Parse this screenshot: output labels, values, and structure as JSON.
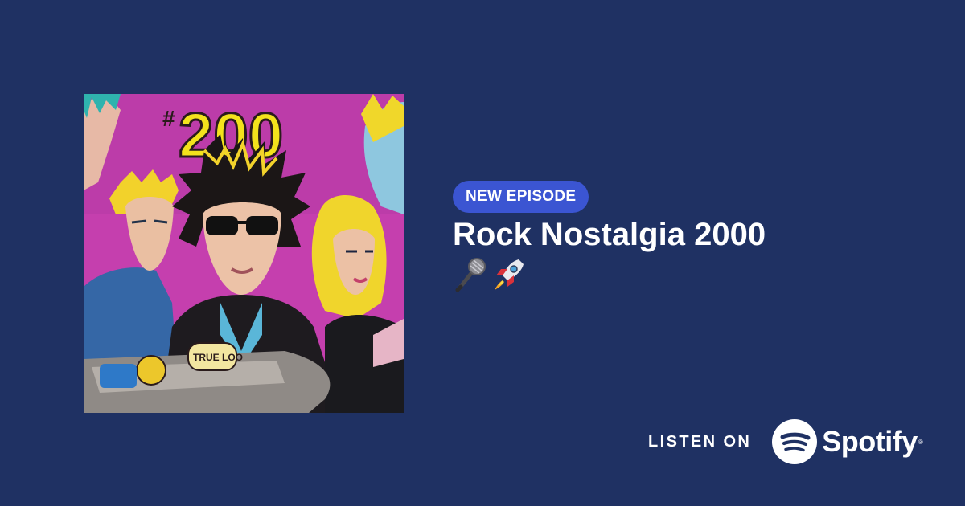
{
  "cover": {
    "alt": "Rock Nostalgia 2000 cover art",
    "art_text": "200",
    "sticker_text": "TRUE LOO"
  },
  "episode": {
    "badge": "NEW EPISODE",
    "title": "Rock Nostalgia 2000",
    "emojis": [
      "microphone-emoji",
      "rocket-emoji"
    ]
  },
  "cta": {
    "listen_on": "LISTEN ON",
    "platform": "Spotify",
    "trademark": "®"
  },
  "colors": {
    "background": "#1f3163",
    "badge": "#3b55d2",
    "text": "#ffffff"
  }
}
